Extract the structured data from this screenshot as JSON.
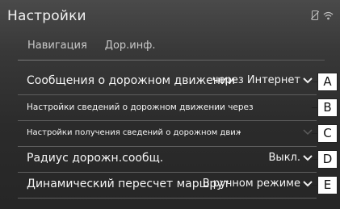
{
  "header": {
    "title": "Настройки"
  },
  "tabs": [
    {
      "label": "Навигация"
    },
    {
      "label": "Дор.инф."
    }
  ],
  "rows": [
    {
      "label": "Сообщения о дорожном движении",
      "value": "через Интернет",
      "callout": "A"
    },
    {
      "label": "Настройки сведений о дорожном движении через",
      "value": "",
      "callout": "B"
    },
    {
      "label": "Настройки получения сведений о дорожном движ",
      "value": "",
      "callout": "C"
    },
    {
      "label": "Радиус дорожн.сообщ.",
      "value": "Выкл.",
      "callout": "D"
    },
    {
      "label": "Динамический пересчет маршрута",
      "value": "В ручном режиме",
      "callout": "E"
    }
  ],
  "icons": {
    "status": [
      "no-phone-icon",
      "wifi-icon"
    ],
    "row_action": "chevron-down-icon"
  },
  "colors": {
    "background": "#2b2b2b",
    "text": "#f5f5f5",
    "divider": "#5e5e5e"
  }
}
